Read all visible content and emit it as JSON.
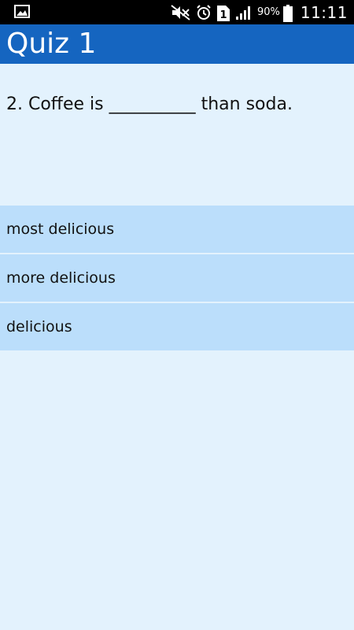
{
  "status_bar": {
    "icons": [
      "image-notification-icon",
      "mute-icon",
      "alarm-icon",
      "sim-card-icon",
      "signal-icon",
      "battery-icon"
    ],
    "battery_percent": "90%",
    "time": "11:11"
  },
  "app_bar": {
    "title": "Quiz 1",
    "color": "#1565c0"
  },
  "question": {
    "text": "2. Coffee is __________ than soda."
  },
  "options": [
    {
      "label": "most delicious"
    },
    {
      "label": "more delicious"
    },
    {
      "label": "delicious"
    }
  ],
  "colors": {
    "background": "#e3f2fd",
    "option_background": "#bbdefb"
  }
}
